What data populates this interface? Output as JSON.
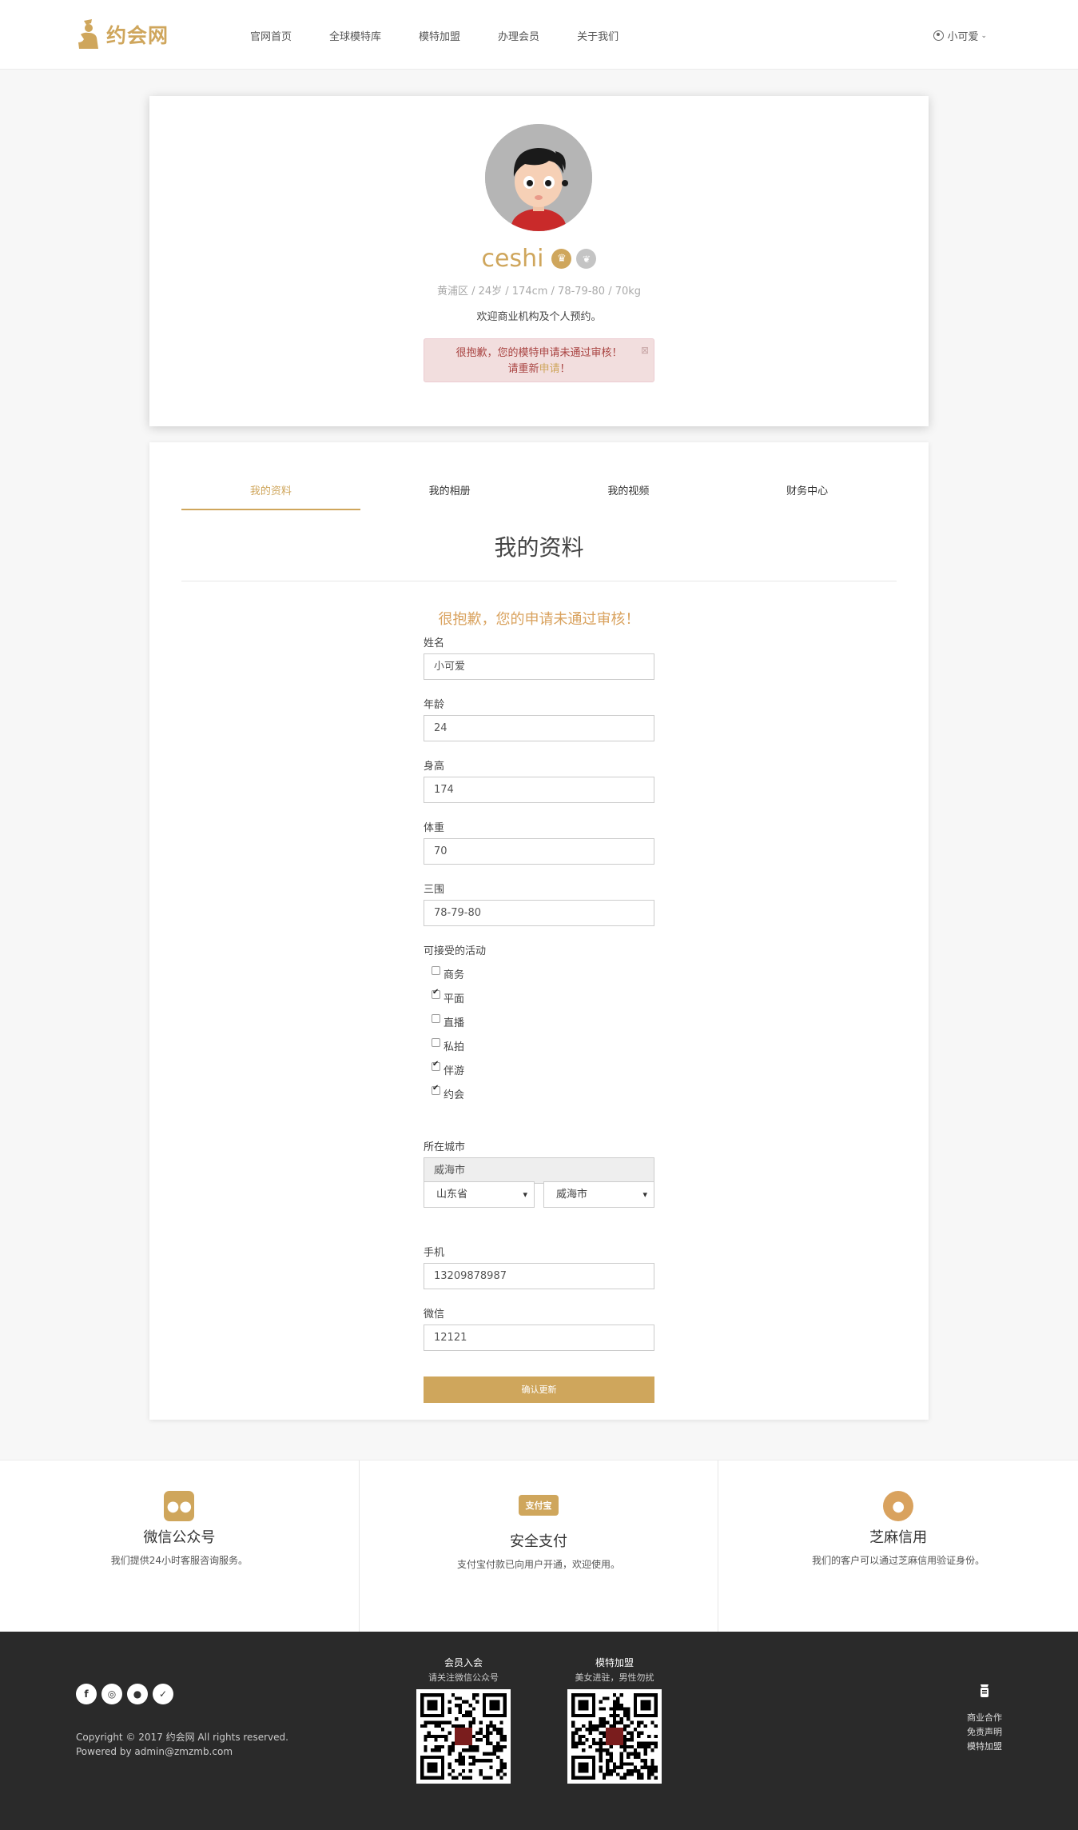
{
  "brand": {
    "name": "约会网",
    "accent": "#cfa65c"
  },
  "nav": {
    "items": [
      "官网首页",
      "全球模特库",
      "模特加盟",
      "办理会员",
      "关于我们"
    ]
  },
  "user": {
    "name": "小可爱"
  },
  "profile": {
    "name": "ceshi",
    "meta": "黄浦区 / 24岁 / 174cm / 78-79-80 / 70kg",
    "intro": "欢迎商业机构及个人预约。",
    "alert_line1": "很抱歉，您的模特申请未通过审核！",
    "alert_line2_prefix": "请重新",
    "alert_line2_link": "申请",
    "alert_line2_suffix": "！",
    "alert_close": "⊠"
  },
  "tabs": [
    "我的资料",
    "我的相册",
    "我的视频",
    "财务中心"
  ],
  "section_title": "我的资料",
  "form": {
    "alert": "很抱歉，您的申请未通过审核！",
    "name_label": "姓名",
    "name_value": "小可爱",
    "age_label": "年龄",
    "age_value": "24",
    "height_label": "身高",
    "height_value": "174",
    "weight_label": "体重",
    "weight_value": "70",
    "measure_label": "三围",
    "measure_value": "78-79-80",
    "activities_label": "可接受的活动",
    "activities": [
      {
        "label": "商务",
        "checked": false
      },
      {
        "label": "平面",
        "checked": true
      },
      {
        "label": "直播",
        "checked": false
      },
      {
        "label": "私拍",
        "checked": false
      },
      {
        "label": "伴游",
        "checked": true
      },
      {
        "label": "约会",
        "checked": true
      }
    ],
    "city_label": "所在城市",
    "city_value": "威海市",
    "province_select": "山东省",
    "city_select": "威海市",
    "phone_label": "手机",
    "phone_value": "13209878987",
    "wechat_label": "微信",
    "wechat_value": "12121",
    "submit_label": "确认更新"
  },
  "features": [
    {
      "icon": "wechat-icon",
      "title": "微信公众号",
      "desc": "我们提供24小时客服咨询服务。"
    },
    {
      "icon": "alipay-icon",
      "title": "安全支付",
      "desc": "支付宝付款已向用户开通，欢迎使用。"
    },
    {
      "icon": "sesame-credit-icon",
      "title": "芝麻信用",
      "desc": "我们的客户可以通过芝麻信用验证身份。"
    }
  ],
  "footer": {
    "copyright": "Copyright © 2017 约会网 All rights reserved.",
    "powered": "Powered by admin@zmzmb.com",
    "qr1_title": "会员入会",
    "qr1_sub": "请关注微信公众号",
    "qr2_title": "模特加盟",
    "qr2_sub": "美女进驻，男性勿扰",
    "links": [
      "商业合作",
      "免责声明",
      "模特加盟"
    ]
  }
}
